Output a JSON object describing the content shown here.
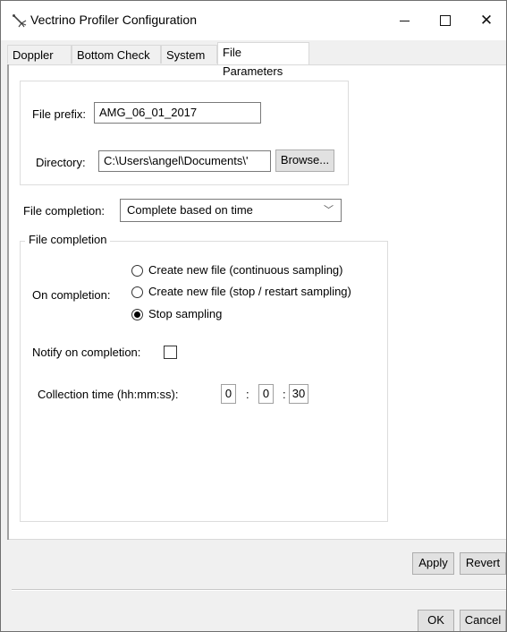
{
  "window": {
    "title": "Vectrino Profiler Configuration",
    "icon": "vectrino-probe-icon"
  },
  "tabs": [
    {
      "label": "Doppler",
      "active": false
    },
    {
      "label": "Bottom Check",
      "active": false
    },
    {
      "label": "System",
      "active": false
    },
    {
      "label": "File Parameters",
      "active": true
    }
  ],
  "file_settings": {
    "prefix_label": "File prefix:",
    "prefix_value": "AMG_06_01_2017",
    "directory_label": "Directory:",
    "directory_value": "C:\\Users\\angel\\Documents\\'",
    "browse_label": "Browse..."
  },
  "completion_select": {
    "label": "File completion:",
    "value": "Complete based on time"
  },
  "completion_group": {
    "title": "File completion",
    "on_completion_label": "On completion:",
    "options": [
      {
        "label": "Create new file (continuous sampling)",
        "selected": false
      },
      {
        "label": "Create new file (stop / restart sampling)",
        "selected": false
      },
      {
        "label": "Stop sampling",
        "selected": true
      }
    ],
    "notify_label": "Notify on completion:",
    "notify_checked": false,
    "collection_time_label": "Collection time (hh:mm:ss):",
    "hours": "0",
    "minutes": "0",
    "seconds": "30",
    "separator": ":"
  },
  "buttons": {
    "apply": "Apply",
    "revert": "Revert",
    "ok": "OK",
    "cancel": "Cancel"
  },
  "colors": {
    "window_bg": "#f0f0f0",
    "panel_bg": "#ffffff",
    "button_bg": "#e1e1e1",
    "radio_selected": "#000000"
  }
}
